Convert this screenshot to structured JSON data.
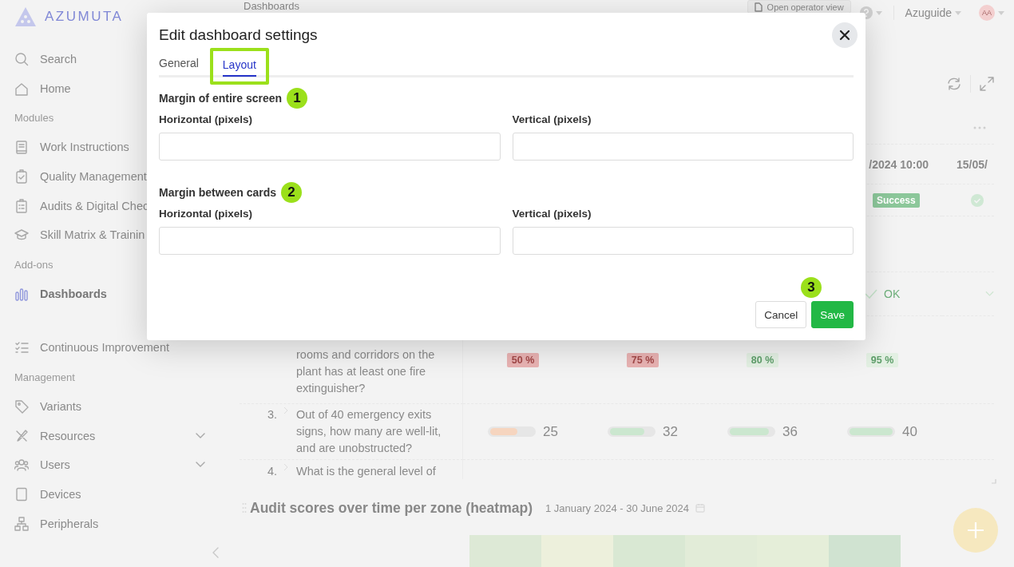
{
  "sidebar": {
    "logo": "AZUMUTA",
    "items": [
      {
        "kind": "item",
        "label": "Search",
        "selected": false
      },
      {
        "kind": "item",
        "label": "Home",
        "selected": false
      },
      {
        "kind": "header",
        "label": "Modules"
      },
      {
        "kind": "item",
        "label": "Work Instructions",
        "selected": false
      },
      {
        "kind": "item",
        "label": "Quality Management",
        "selected": false
      },
      {
        "kind": "item",
        "label": "Audits & Digital Chec",
        "selected": false
      },
      {
        "kind": "item",
        "label": "Skill Matrix & Trainin",
        "selected": false
      },
      {
        "kind": "header",
        "label": "Add-ons"
      },
      {
        "kind": "item",
        "label": "Dashboards",
        "selected": true
      },
      {
        "kind": "item",
        "label": "Continuous Improvement",
        "selected": false
      },
      {
        "kind": "header",
        "label": "Management"
      },
      {
        "kind": "item",
        "label": "Variants",
        "selected": false
      },
      {
        "kind": "item",
        "label": "Resources",
        "selected": false,
        "expanded": false
      },
      {
        "kind": "item",
        "label": "Users",
        "selected": false,
        "expanded": false
      },
      {
        "kind": "item",
        "label": "Devices",
        "selected": false
      },
      {
        "kind": "item",
        "label": "Peripherals",
        "selected": false
      }
    ]
  },
  "header": {
    "title": "Dashboards",
    "operator_button": "Open operator view",
    "workspace": "Azuguide",
    "avatar": "AA"
  },
  "table": {
    "date_cells": [
      "/2024 10:00",
      "15/05/"
    ],
    "status_badge": "Success",
    "result": "OK",
    "questions": [
      {
        "kind": "percent",
        "text": "rooms and corridors on the plant has at least one fire extinguisher?",
        "values": [
          {
            "text": "50 %",
            "color": "#e9b3b3"
          },
          {
            "text": "75 %",
            "color": "#e9b3b3"
          },
          {
            "text": "80 %",
            "color": "#e3f0e3"
          },
          {
            "text": "95 %",
            "color": "#e3f0e3"
          }
        ]
      },
      {
        "kind": "count",
        "number": "3.",
        "text": "Out of 40 emergency exits signs, how many are well-lit, and are unobstructed?",
        "values": [
          {
            "text": "25",
            "level": 0.63,
            "color": "#f6d5bf"
          },
          {
            "text": "32",
            "level": 0.8,
            "color": "#cbe7cf"
          },
          {
            "text": "36",
            "level": 0.9,
            "color": "#cbe7cf"
          },
          {
            "text": "40",
            "level": 1,
            "color": "#cbe7cf"
          }
        ]
      },
      {
        "kind": "text",
        "number": "4.",
        "text": "What is the general level of"
      }
    ]
  },
  "heatmap": {
    "title": "Audit scores over time per zone (heatmap)",
    "date_range": "1 January 2024 - 30 June 2024",
    "cells": [
      {
        "color": "#dde9d6"
      },
      {
        "color": "#edf0dc"
      },
      {
        "color": "#d9e8d3"
      },
      {
        "color": "#e2ecd8"
      },
      {
        "color": "#e5eed9"
      },
      {
        "color": "#d0e3d1"
      }
    ]
  },
  "dialog": {
    "title": "Edit dashboard settings",
    "tabs": [
      {
        "label": "General",
        "selected": false,
        "highlighted": false
      },
      {
        "label": "Layout",
        "selected": true,
        "highlighted": true
      }
    ],
    "sections": [
      {
        "title": "Margin of entire screen",
        "annotation": "1",
        "fields": [
          {
            "label": "Horizontal (pixels)"
          },
          {
            "label": "Vertical (pixels)"
          }
        ]
      },
      {
        "title": "Margin between cards",
        "annotation": "2",
        "fields": [
          {
            "label": "Horizontal (pixels)"
          },
          {
            "label": "Vertical (pixels)"
          }
        ]
      }
    ],
    "footer_annotation": "3",
    "buttons": [
      {
        "kind": "secondary",
        "label": "Cancel"
      },
      {
        "kind": "primary",
        "label": "Save"
      }
    ]
  }
}
